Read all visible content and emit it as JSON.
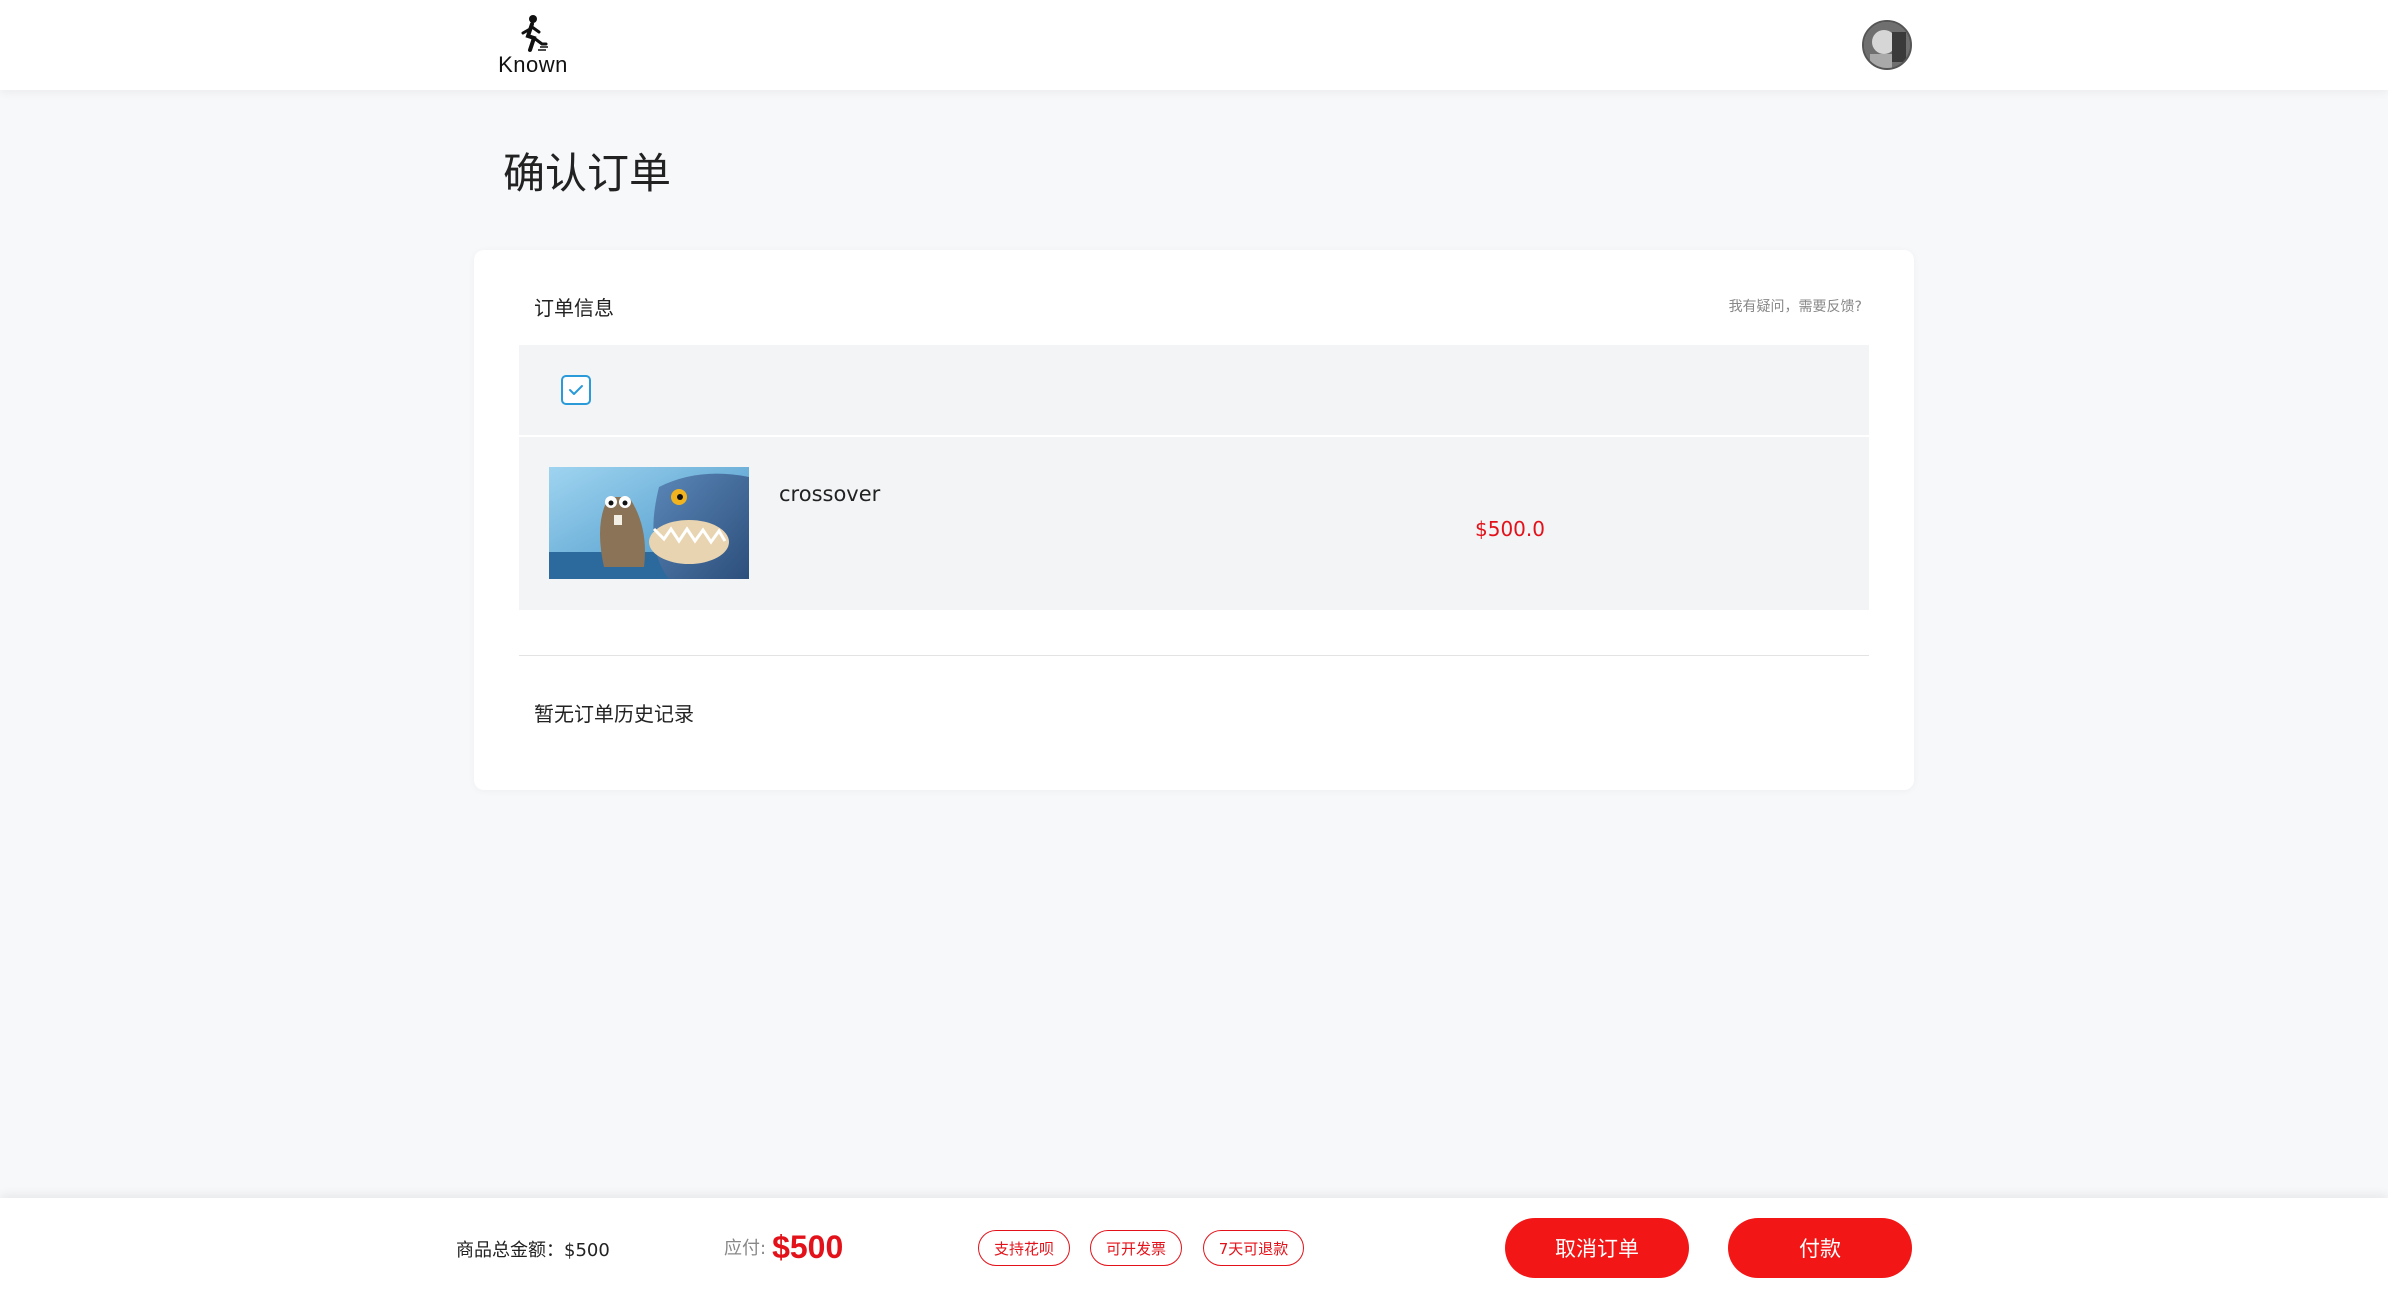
{
  "header": {
    "logo_text": "Known",
    "avatar_alt": "user-avatar"
  },
  "page": {
    "title": "确认订单"
  },
  "order_card": {
    "title": "订单信息",
    "feedback_link": "我有疑问，需要反馈?",
    "checkbox_checked": true,
    "item": {
      "name": "crossover",
      "price": "$500.0"
    },
    "history_empty": "暂无订单历史记录"
  },
  "footer": {
    "total_label": "商品总金额：$500",
    "payable_label": "应付:",
    "payable_amount": "$500",
    "tags": [
      "支持花呗",
      "可开发票",
      "7天可退款"
    ],
    "cancel_button": "取消订单",
    "pay_button": "付款"
  },
  "colors": {
    "accent_red": "#e3121a",
    "button_red": "#f21616",
    "checkbox_blue": "#2b9ad9"
  }
}
